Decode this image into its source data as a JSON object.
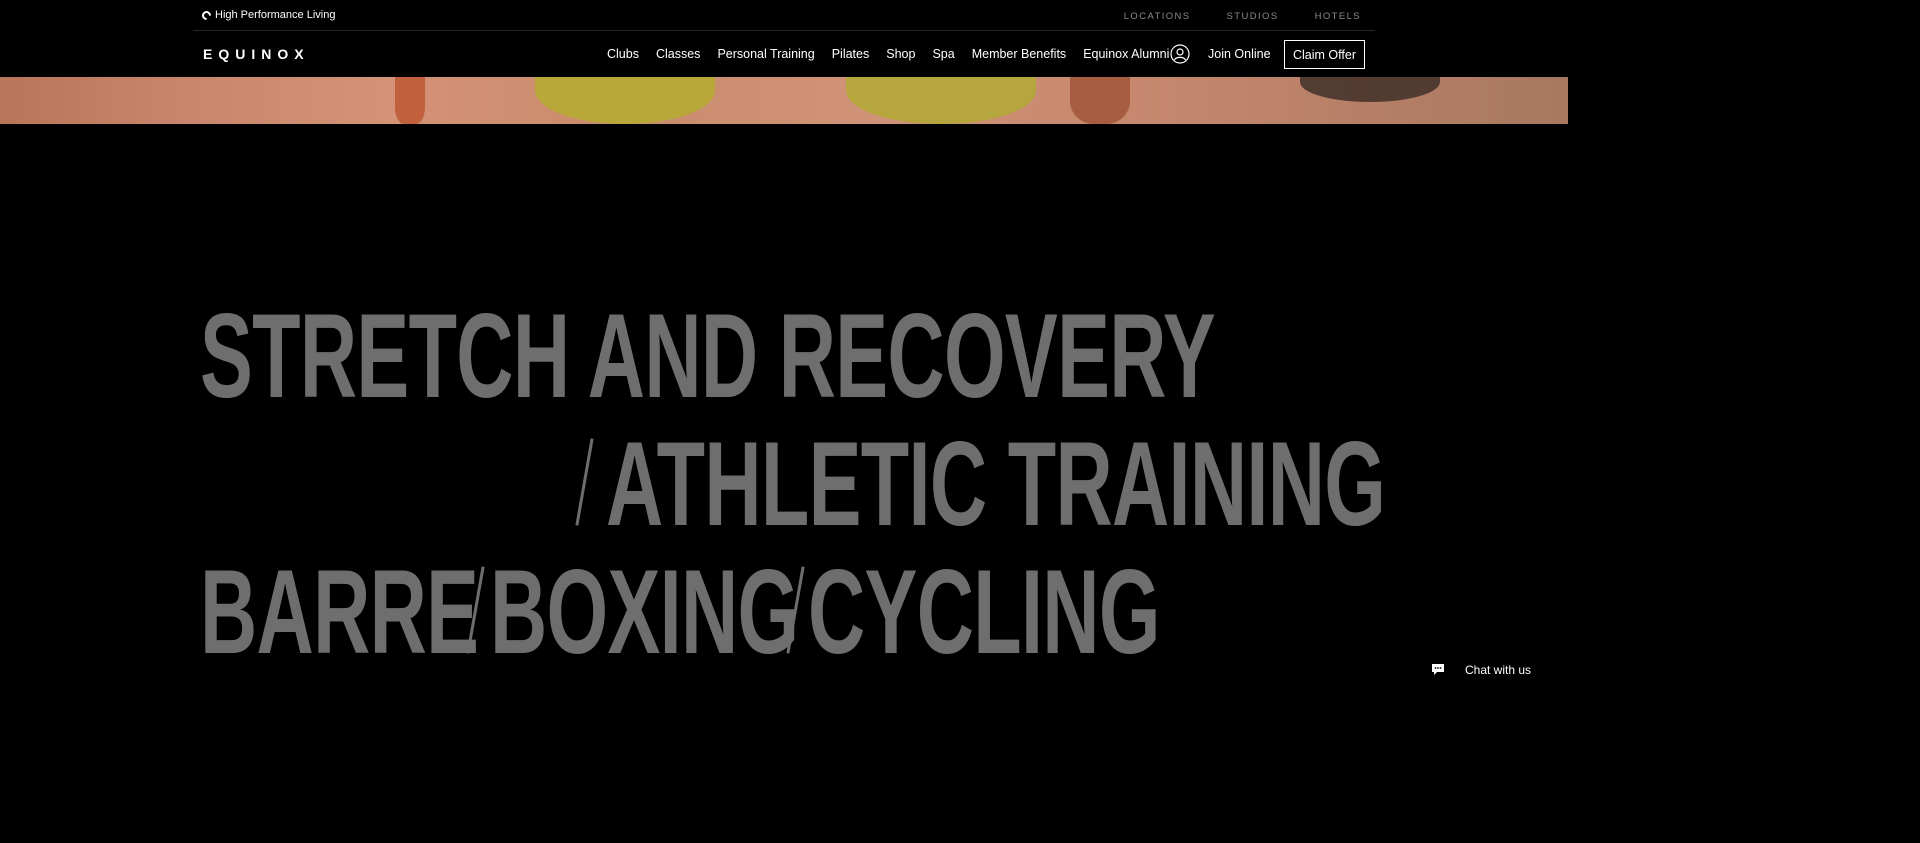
{
  "util_bar": {
    "tagline": "High Performance Living",
    "links": [
      "LOCATIONS",
      "STUDIOS",
      "HOTELS"
    ]
  },
  "nav": {
    "logo": "EQUINOX",
    "links": [
      "Clubs",
      "Classes",
      "Personal Training",
      "Pilates",
      "Shop",
      "Spa",
      "Member Benefits",
      "Equinox Alumni"
    ],
    "join_online": "Join Online",
    "claim_offer": "Claim Offer"
  },
  "headline": {
    "line1": "STRETCH AND RECOVERY",
    "line2": "ATHLETIC TRAINING",
    "line3_a": "BARRE",
    "line3_b": "BOXING",
    "line3_c": "CYCLING"
  },
  "chat": {
    "label": "Chat with us"
  },
  "colors": {
    "background": "#000000",
    "headline_text": "#6e6e6e",
    "util_link": "#8a8a8a"
  },
  "icons": [
    "refresh-icon",
    "account-icon",
    "chat-icon"
  ]
}
